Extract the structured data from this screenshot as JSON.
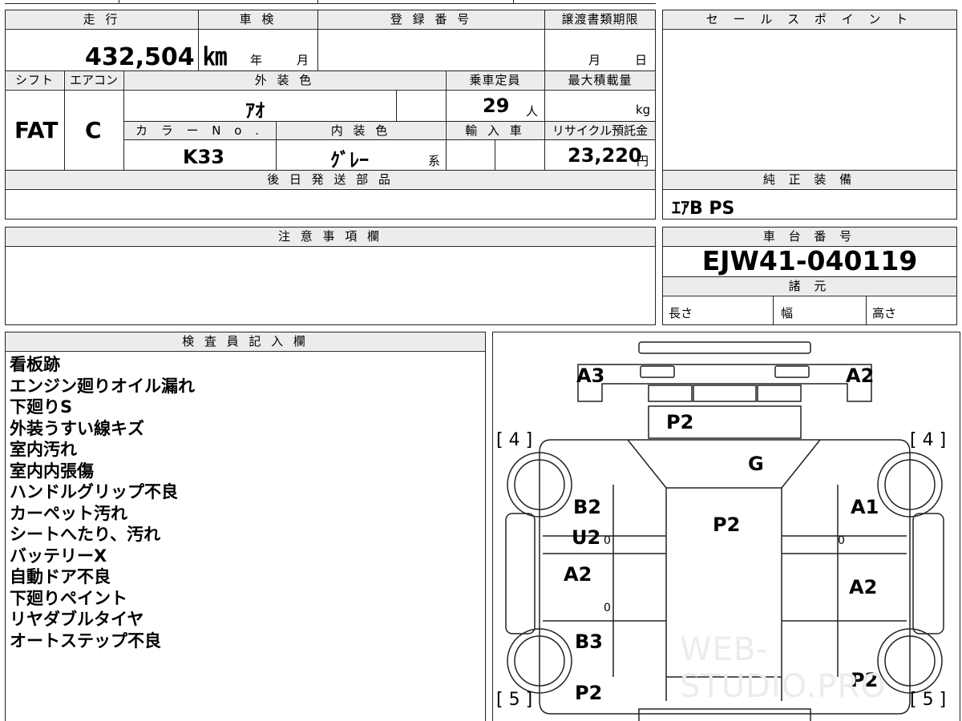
{
  "top_row": {
    "mileage_label": "走 行",
    "mileage_value": "432,504 ㎞",
    "inspection_label": "車 検",
    "inspection_year": "年",
    "inspection_month": "月",
    "registration_label": "登 録 番 号",
    "transfer_label": "譲渡書類期限",
    "transfer_month": "月",
    "transfer_day": "日"
  },
  "spec_row": {
    "shift_label": "シフト",
    "shift_value": "FAT",
    "ac_label": "エアコン",
    "ac_value": "C",
    "exterior_color_label": "外 装 色",
    "exterior_color_value": "ｱｵ",
    "capacity_label": "乗車定員",
    "capacity_value": "29",
    "capacity_unit": "人",
    "max_load_label": "最大積載量",
    "max_load_unit": "kg",
    "color_no_label": "カ ラ ー N o .",
    "color_no_value": "K33",
    "interior_color_label": "内 装 色",
    "interior_color_value": "ｸﾞﾚｰ",
    "interior_color_suffix": "系",
    "import_label": "輸 入 車",
    "recycle_label": "リサイクル預託金",
    "recycle_value": "23,220",
    "recycle_unit": "円"
  },
  "later_parts": {
    "label": "後 日 発 送 部 品"
  },
  "sales_point": {
    "label": "セ ー ル ス ポ イ ン ト"
  },
  "genuine_equipment": {
    "label": "純 正 装 備",
    "value": "ｴｱB PS"
  },
  "caution": {
    "label": "注 意 事 項 欄"
  },
  "chassis": {
    "label": "車 台 番 号",
    "value": "EJW41-040119"
  },
  "specs": {
    "label": "諸 元",
    "length": "長さ",
    "width": "幅",
    "height": "高さ"
  },
  "inspector": {
    "label": "検 査 員 記 入 欄",
    "notes": [
      "看板跡",
      "エンジン廻りオイル漏れ",
      "下廻りS",
      "外装うすい線キズ",
      "室内汚れ",
      "室内内張傷",
      "ハンドルグリップ不良",
      "カーペット汚れ",
      "シートへたり、汚れ",
      "バッテリーX",
      "自動ドア不良",
      "下廻りペイント",
      "リヤダブルタイヤ",
      "オートステップ不良"
    ]
  },
  "damage_map": {
    "front_left": "A3",
    "front_right": "A2",
    "front_panel": "P2",
    "windshield": "G",
    "left_front": "B2",
    "left_u": "U2",
    "left_mid": "A2",
    "left_rear": "B3",
    "left_bottom": "P2",
    "roof": "P2",
    "right_front": "A1",
    "right_mid": "A2",
    "right_rear": "P2",
    "tire_front_left": "[ 4 ]",
    "tire_front_right": "[ 4 ]",
    "tire_rear_left": "[ 5 ]",
    "tire_rear_right": "[ 5 ]",
    "zero_1": "0",
    "zero_2": "0",
    "zero_3": "0"
  },
  "watermark": "WEB-STUDIO.PRO"
}
